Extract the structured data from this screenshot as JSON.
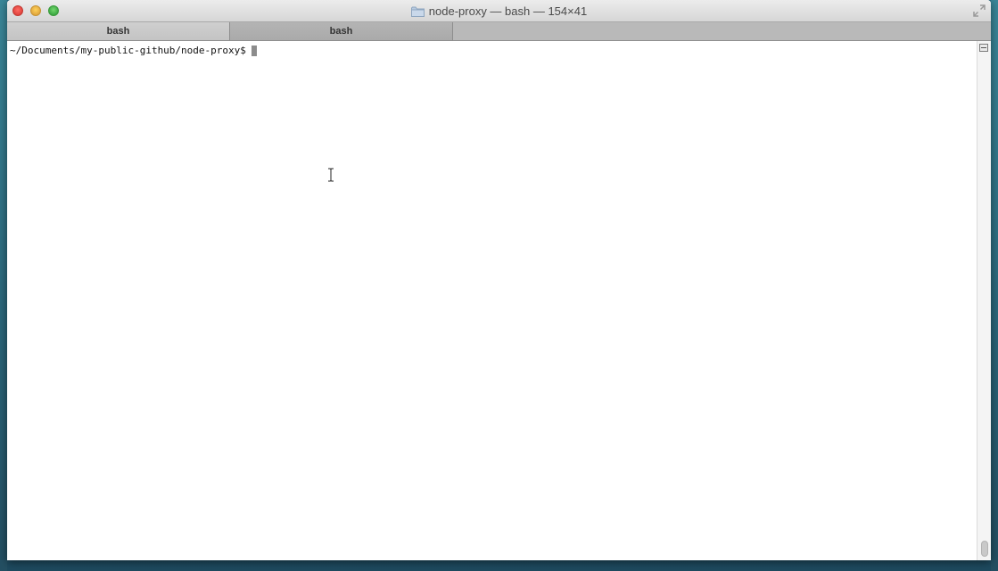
{
  "window": {
    "title": "node-proxy — bash — 154×41"
  },
  "tabs": [
    {
      "label": "bash",
      "active": true
    },
    {
      "label": "bash",
      "active": false
    }
  ],
  "terminal": {
    "prompt": "~/Documents/my-public-github/node-proxy$"
  },
  "colors": {
    "close": "#e0443e",
    "minimize": "#e1a73e",
    "zoom": "#3ea945",
    "cursor": "#8c8c8c"
  }
}
